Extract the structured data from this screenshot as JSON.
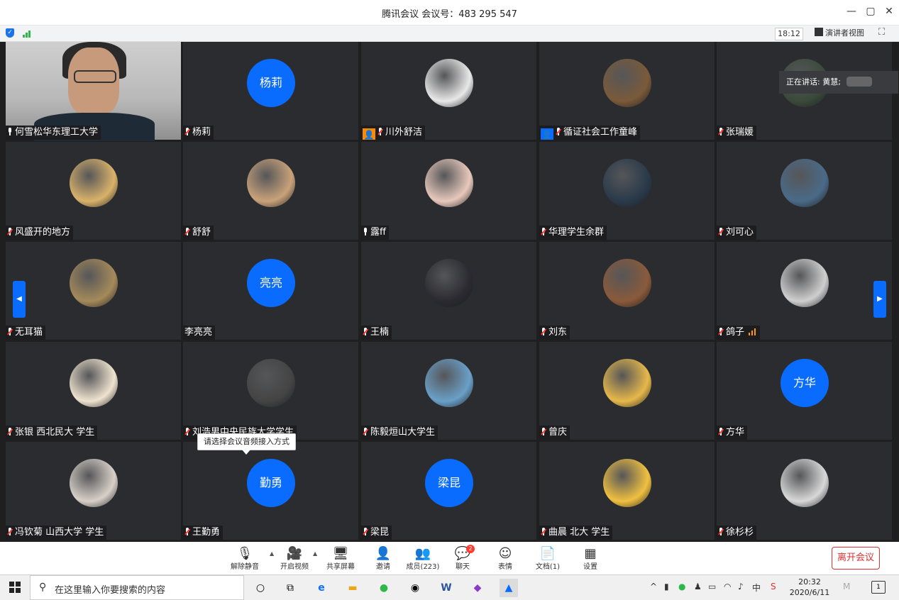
{
  "window": {
    "title": "腾讯会议 会议号：483 295 547",
    "minimize": "—",
    "restore": "▢",
    "close": "✕"
  },
  "status": {
    "time": "18:12",
    "speaker_view": "演讲者视图",
    "fullscreen": "⛶",
    "shield": "✓"
  },
  "speaking": {
    "label": "正在讲话: 黄慧;"
  },
  "tiles": [
    {
      "name": "何雪松华东理工大学",
      "mic": "on",
      "kind": "video"
    },
    {
      "name": "杨莉",
      "mic": "muted",
      "kind": "text",
      "avatar_text": "杨莉"
    },
    {
      "name": "川外舒洁",
      "mic": "muted",
      "kind": "img",
      "badge": "orange",
      "avatar_color": "#e8e8e8"
    },
    {
      "name": "循证社会工作童峰",
      "mic": "muted",
      "kind": "img",
      "badge": "blue",
      "avatar_color": "#7a5a3a"
    },
    {
      "name": "张瑞媛",
      "mic": "muted",
      "kind": "img",
      "avatar_color": "#3a4a3a"
    },
    {
      "name": "风盛开的地方",
      "mic": "muted",
      "kind": "img",
      "avatar_color": "#d9b26a"
    },
    {
      "name": "舒舒",
      "mic": "muted",
      "kind": "img",
      "avatar_color": "#c9a27a"
    },
    {
      "name": "露ff",
      "mic": "on",
      "kind": "img",
      "avatar_color": "#e7c8bb"
    },
    {
      "name": "华理学生余群",
      "mic": "muted",
      "kind": "img",
      "avatar_color": "#2a3a4a"
    },
    {
      "name": "刘可心",
      "mic": "muted",
      "kind": "img",
      "avatar_color": "#4a6a88"
    },
    {
      "name": "无耳猫",
      "mic": "muted",
      "kind": "img",
      "avatar_color": "#a58a5a"
    },
    {
      "name": "李亮亮",
      "mic": "none",
      "kind": "text",
      "avatar_text": "亮亮"
    },
    {
      "name": "王楠",
      "mic": "muted",
      "kind": "img",
      "avatar_color": "#2a2a30"
    },
    {
      "name": "刘东",
      "mic": "muted",
      "kind": "img",
      "avatar_color": "#8a5a3a"
    },
    {
      "name": "鸽子",
      "mic": "muted",
      "kind": "img",
      "avatar_color": "#cfcfcf",
      "netbars": true
    },
    {
      "name": "张银 西北民大 学生",
      "mic": "muted",
      "kind": "img",
      "avatar_color": "#efe3cf"
    },
    {
      "name": "刘浩男中央民族大学学生",
      "mic": "muted",
      "kind": "img",
      "avatar_color": "#444444"
    },
    {
      "name": "陈毅烜山大学生",
      "mic": "muted",
      "kind": "img",
      "avatar_color": "#6aa0c8"
    },
    {
      "name": "曾庆",
      "mic": "muted",
      "kind": "img",
      "avatar_color": "#e7b84a"
    },
    {
      "name": "方华",
      "mic": "muted",
      "kind": "text",
      "avatar_text": "方华"
    },
    {
      "name": "冯钦菊 山西大学 学生",
      "mic": "muted",
      "kind": "img",
      "avatar_color": "#d8d0c8"
    },
    {
      "name": "王勤勇",
      "mic": "muted",
      "kind": "text",
      "avatar_text": "勤勇"
    },
    {
      "name": "梁昆",
      "mic": "muted",
      "kind": "text",
      "avatar_text": "梁昆"
    },
    {
      "name": "曲晨 北大 学生",
      "mic": "muted",
      "kind": "img",
      "avatar_color": "#f0c040"
    },
    {
      "name": "徐杉杉",
      "mic": "muted",
      "kind": "img",
      "avatar_color": "#d8d8d8"
    }
  ],
  "tooltip": "请选择会议音频接入方式",
  "nav": {
    "prev": "◀",
    "next": "▶"
  },
  "toolbar": {
    "unmute": "解除静音",
    "start_video": "开启视频",
    "share": "共享屏幕",
    "invite": "邀请",
    "members": "成员(223)",
    "chat": "聊天",
    "chat_badge": "2",
    "reactions": "表情",
    "docs": "文档(1)",
    "settings": "设置",
    "leave": "离开会议"
  },
  "taskbar": {
    "search_placeholder": "在这里输入你要搜索的内容",
    "ime": "中",
    "clock_time": "20:32",
    "clock_date": "2020/6/11",
    "notif_count": "1"
  },
  "colors": {
    "accent": "#0a6cff",
    "danger": "#e0302f"
  }
}
